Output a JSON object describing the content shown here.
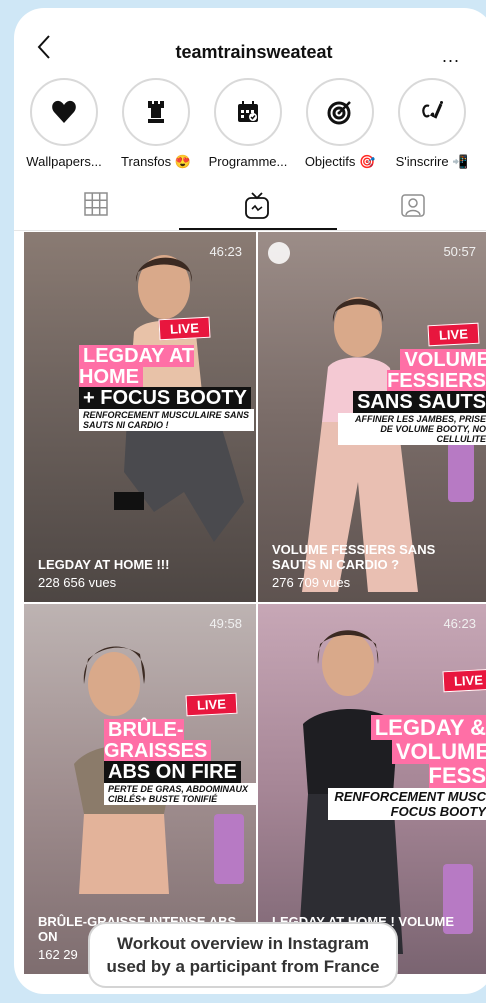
{
  "header": {
    "title": "teamtrainsweateat",
    "more_label": "..."
  },
  "highlights": [
    {
      "label": "Wallpapers...",
      "icon": "heart-icon"
    },
    {
      "label": "Transfos 😍",
      "icon": "chess-rook-icon"
    },
    {
      "label": "Programme...",
      "icon": "calendar-icon"
    },
    {
      "label": "Objectifs 🎯",
      "icon": "target-icon"
    },
    {
      "label": "S'inscrire 📲",
      "icon": "signature-icon"
    }
  ],
  "tabs": [
    {
      "name": "grid",
      "icon": "grid-icon"
    },
    {
      "name": "igtv",
      "icon": "tv-icon",
      "selected": true
    },
    {
      "name": "tagged",
      "icon": "tagged-person-icon"
    }
  ],
  "videos": [
    {
      "duration": "46:23",
      "live": "LIVE",
      "overlay_line1": "LEGDAY AT HOME",
      "overlay_line2": "+ FOCUS BOOTY",
      "overlay_sub": "RENFORCEMENT MUSCULAIRE SANS SAUTS NI CARDIO !",
      "caption": "LEGDAY AT HOME !!!",
      "views": "228 656 vues"
    },
    {
      "duration": "50:57",
      "live": "LIVE",
      "overlay_line1": "VOLUME FESSIERS",
      "overlay_line2": "SANS SAUTS",
      "overlay_sub": "AFFINER LES JAMBES, PRISE DE VOLUME BOOTY, NO CELLULITE",
      "caption": "VOLUME FESSIERS SANS SAUTS NI CARDIO ?",
      "views": "276 709 vues"
    },
    {
      "duration": "49:58",
      "live": "LIVE",
      "overlay_line1": "BRÛLE-GRAISSES",
      "overlay_line2": "ABS ON FIRE",
      "overlay_sub": "PERTE DE GRAS, ABDOMINAUX CIBLÉS+ BUSTE TONIFIÉ",
      "caption": "BRÛLE-GRAISSE INTENSE ABS ON",
      "views": "162 29"
    },
    {
      "duration": "46:23",
      "live": "LIVE",
      "overlay_line1": "LEGDAY &",
      "overlay_line2": "VOLUME FESS",
      "overlay_sub": "RENFORCEMENT MUSC FOCUS BOOTY",
      "caption": "LEGDAY AT HOME ! Volume ...tion...",
      "views": ""
    }
  ],
  "banner": {
    "line1": "Workout overview in Instagram",
    "line2": "used by a participant from France"
  }
}
